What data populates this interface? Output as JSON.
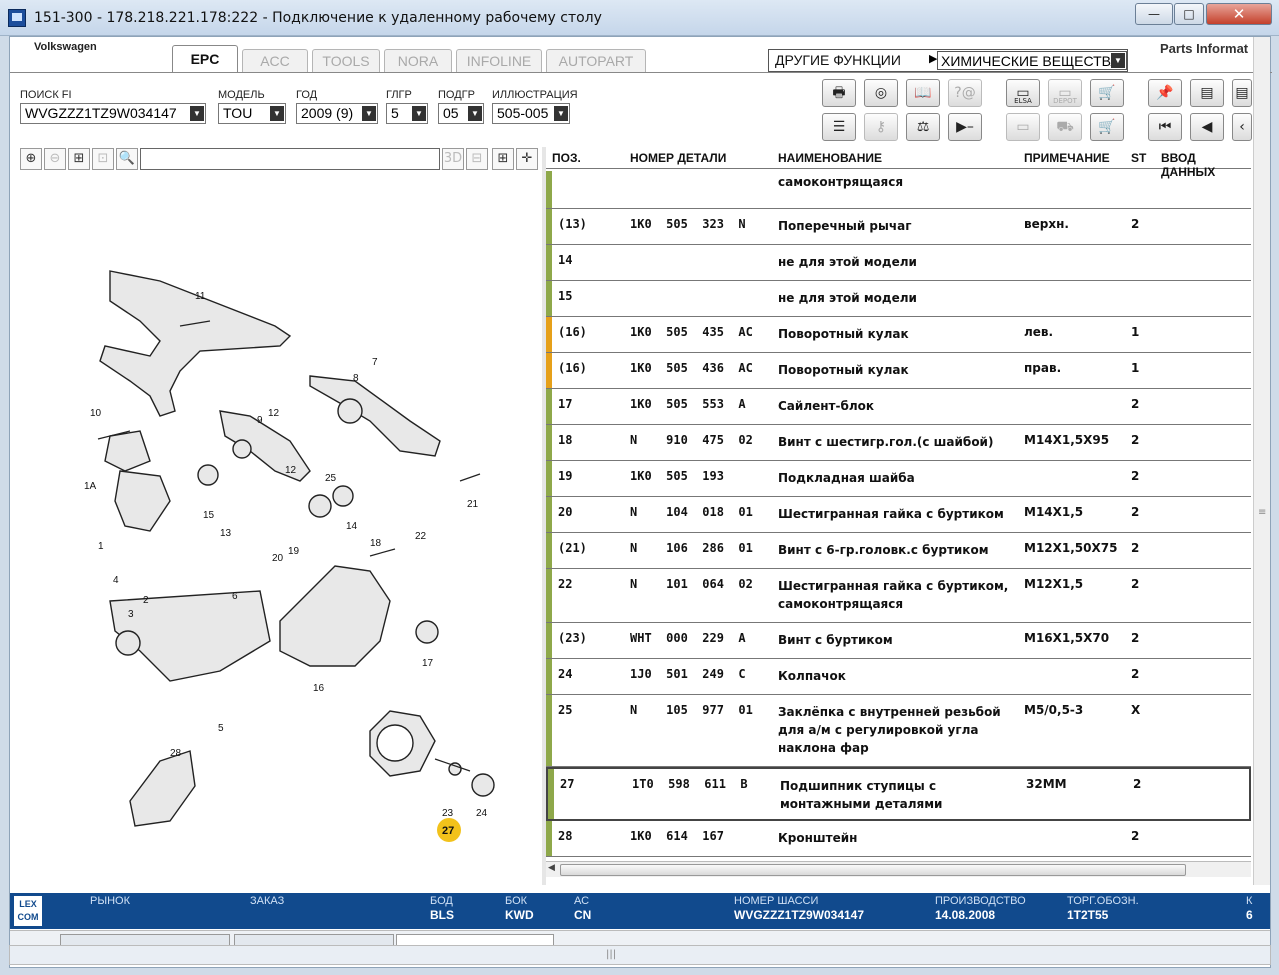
{
  "window": {
    "title": "151-300 - 178.218.221.178:222 - Подключение к удаленному рабочему столу",
    "min": "—",
    "max": "□",
    "close": "✕"
  },
  "header": {
    "brand": "Volkswagen",
    "tabs": [
      "EPC",
      "ACC",
      "TOOLS",
      "NORA",
      "INFOLINE",
      "AUTOPART"
    ],
    "other_functions_label": "ДРУГИЕ ФУНКЦИИ",
    "other_functions_value": "ХИМИЧЕСКИЕ ВЕЩЕСТВА",
    "partner_logo": "Parts Informat"
  },
  "filters": {
    "search_fi": {
      "label": "ПОИСК FI",
      "value": "WVGZZZ1TZ9W034147"
    },
    "model": {
      "label": "МОДЕЛЬ",
      "value": "TOU"
    },
    "year": {
      "label": "ГОД",
      "value": "2009 (9)"
    },
    "mg": {
      "label": "ГЛГР",
      "value": "5"
    },
    "sg": {
      "label": "ПОДГР",
      "value": "05"
    },
    "illustration": {
      "label": "ИЛЛЮСТРАЦИЯ",
      "value": "505-005"
    }
  },
  "toolbar": {
    "elsa": "ELSA",
    "depot": "DEPOT"
  },
  "table": {
    "headers": {
      "pos": "ПОЗ.",
      "part": "НОМЕР ДЕТАЛИ",
      "name": "НАИМЕНОВАНИЕ",
      "note": "ПРИМЕЧАНИЕ",
      "st": "ST",
      "input": "ВВОД ДАННЫХ"
    },
    "rows": [
      {
        "pos": "",
        "part": "",
        "name": "самоконтрящаяся",
        "note": "",
        "st": "",
        "mark": "green"
      },
      {
        "pos": "(13)",
        "part": "1K0  505  323  N",
        "name": "Поперечный рычаг",
        "note": "верхн.",
        "st": "2",
        "mark": "green"
      },
      {
        "pos": "14",
        "part": "",
        "name": "не для этой модели",
        "note": "",
        "st": "",
        "mark": "green"
      },
      {
        "pos": "15",
        "part": "",
        "name": "не для этой модели",
        "note": "",
        "st": "",
        "mark": "green"
      },
      {
        "pos": "(16)",
        "part": "1K0  505  435  AC",
        "name": "Поворотный кулак",
        "note": "лев.",
        "st": "1",
        "mark": "orange"
      },
      {
        "pos": "(16)",
        "part": "1K0  505  436  AC",
        "name": "Поворотный кулак",
        "note": "прав.",
        "st": "1",
        "mark": "orange"
      },
      {
        "pos": "17",
        "part": "1K0  505  553  A",
        "name": "Сайлент-блок",
        "note": "",
        "st": "2",
        "mark": "green"
      },
      {
        "pos": "18",
        "part": "N    910  475  02",
        "name": "Винт с шестигр.гол.(с шайбой)",
        "note": "M14X1,5X95",
        "st": "2",
        "mark": "green"
      },
      {
        "pos": "19",
        "part": "1K0  505  193",
        "name": "Подкладная шайба",
        "note": "",
        "st": "2",
        "mark": "green"
      },
      {
        "pos": "20",
        "part": "N    104  018  01",
        "name": "Шестигранная гайка с буртиком",
        "note": "M14X1,5",
        "st": "2",
        "mark": "green"
      },
      {
        "pos": "(21)",
        "part": "N    106  286  01",
        "name": "Винт с 6-гр.головк.с буртиком",
        "note": "M12X1,50X75",
        "st": "2",
        "mark": "green"
      },
      {
        "pos": "22",
        "part": "N    101  064  02",
        "name": "Шестигранная гайка с буртиком, самоконтрящаяся",
        "note": "M12X1,5",
        "st": "2",
        "mark": "green"
      },
      {
        "pos": "(23)",
        "part": "WHT  000  229  A",
        "name": "Винт с буртиком",
        "note": "M16X1,5X70",
        "st": "2",
        "mark": "green"
      },
      {
        "pos": "24",
        "part": "1J0  501  249  C",
        "name": "Колпачок",
        "note": "",
        "st": "2",
        "mark": "green"
      },
      {
        "pos": "25",
        "part": "N    105  977  01",
        "name": "Заклёпка с внутренней резьбой для а/м с регулировкой угла наклона фар",
        "note": "M5/0,5-3",
        "st": "X",
        "mark": "green"
      },
      {
        "pos": "27",
        "part": "1T0  598  611  B",
        "name": "Подшипник ступицы с монтажными деталями",
        "note": "32MM",
        "st": "2",
        "mark": "green"
      },
      {
        "pos": "28",
        "part": "1K0  614  167",
        "name": "Кронштейн",
        "note": "",
        "st": "2",
        "mark": "green"
      }
    ]
  },
  "illustration_callouts": [
    "11",
    "7",
    "8",
    "10",
    "12",
    "9",
    "12",
    "25",
    "1A",
    "15",
    "13",
    "14",
    "21",
    "22",
    "18",
    "20",
    "19",
    "1",
    "4",
    "6",
    "2",
    "3",
    "17",
    "16",
    "5",
    "28",
    "23",
    "24",
    "27"
  ],
  "status": {
    "logo": "LEX COM",
    "market_label": "РЫНОК",
    "order_label": "ЗАКАЗ",
    "bod_label": "БОД",
    "bod_value": "BLS",
    "bok_label": "БОК",
    "bok_value": "KWD",
    "ac_label": "АС",
    "ac_value": "CN",
    "chassis_label": "НОМЕР ШАССИ",
    "chassis_value": "WVGZZZ1TZ9W034147",
    "prod_label": "ПРОИЗВОДСТВО",
    "prod_value": "14.08.2008",
    "trade_label": "ТОРГ.ОБОЗН.",
    "trade_value": "1T2T55",
    "extra_label": "К",
    "extra_value": "6"
  },
  "colors": {
    "accent_green": "#8ea84a",
    "accent_orange": "#e6a019",
    "status_blue": "#114a8d",
    "callout_yellow": "#f2c21b"
  }
}
